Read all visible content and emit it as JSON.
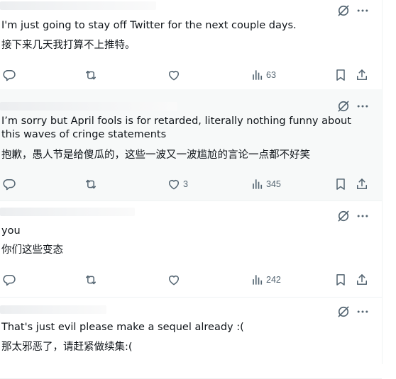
{
  "tweets": [
    {
      "text_en": "I'm just going to stay off Twitter for the next couple days.",
      "text_zh": "接下来几天我打算不上推特。",
      "replies": "",
      "retweets": "",
      "likes": "",
      "views": "63"
    },
    {
      "text_en": "I’m sorry but April fools is for retarded, literally nothing funny about this waves of cringe statements",
      "text_zh": "抱歉，愚人节是给傻瓜的，这些一波又一波尴尬的言论一点都不好笑",
      "replies": "",
      "retweets": "",
      "likes": "3",
      "views": "345"
    },
    {
      "text_en": "you",
      "text_zh": "你们这些变态",
      "replies": "",
      "retweets": "",
      "likes": "",
      "views": "242"
    },
    {
      "text_en": "That's just evil please make a sequel already :(",
      "text_zh": "那太邪恶了，请赶紧做续集:(",
      "replies": "",
      "retweets": "",
      "likes": "",
      "views": ""
    }
  ],
  "icons": {
    "grok": "grok-icon",
    "more": "more-icon",
    "reply": "reply-icon",
    "retweet": "retweet-icon",
    "like": "like-icon",
    "views": "views-icon",
    "bookmark": "bookmark-icon",
    "share": "share-icon"
  },
  "colors": {
    "text": "#0f1419",
    "muted": "#536471",
    "divider": "#eff3f4",
    "hover_bg": "#f7f9f9"
  }
}
